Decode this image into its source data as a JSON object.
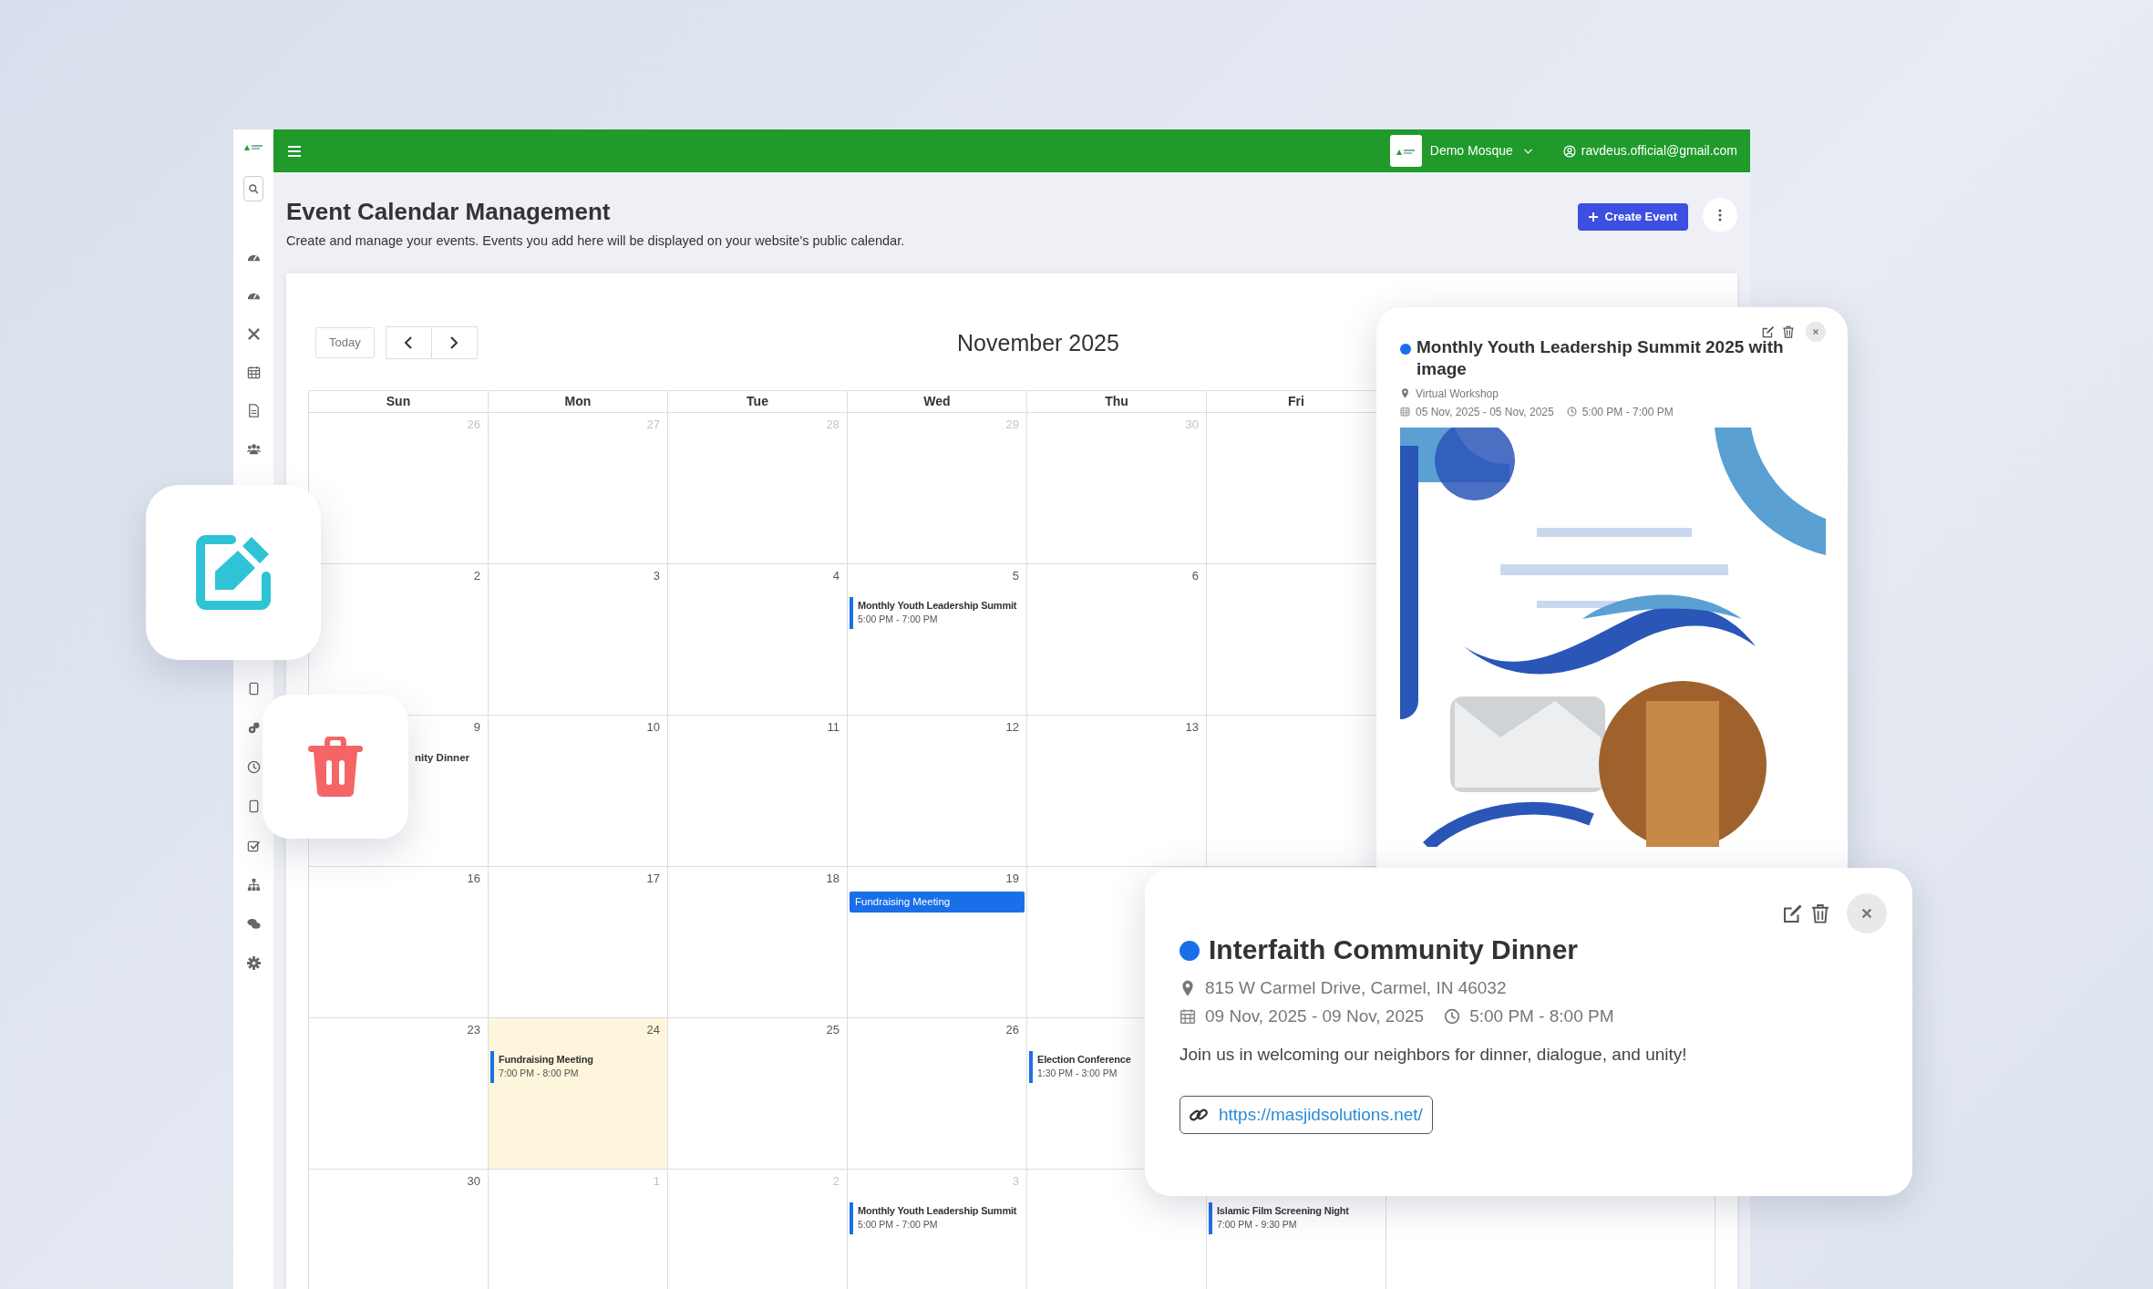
{
  "topbar": {
    "account": "Demo Mosque",
    "email": "ravdeus.official@gmail.com"
  },
  "header": {
    "title": "Event Calendar Management",
    "subtitle": "Create and manage your events. Events you add here will be displayed on your website's public calendar.",
    "create_button": "Create Event"
  },
  "calendar": {
    "today_button": "Today",
    "month_title": "November 2025",
    "weekdays": [
      "Sun",
      "Mon",
      "Tue",
      "Wed",
      "Thu",
      "Fri"
    ],
    "weeks": [
      [
        {
          "kind": "day",
          "day": "26",
          "outside": true,
          "today": false
        },
        {
          "kind": "day",
          "day": "27",
          "outside": true,
          "today": false
        },
        {
          "kind": "day",
          "day": "28",
          "outside": true,
          "today": false
        },
        {
          "kind": "day",
          "day": "29",
          "outside": true,
          "today": false
        },
        {
          "kind": "day",
          "day": "30",
          "outside": true,
          "today": false
        },
        {
          "kind": "blank"
        }
      ],
      [
        {
          "kind": "day",
          "day": "2",
          "outside": false,
          "today": false
        },
        {
          "kind": "day",
          "day": "3",
          "outside": false,
          "today": false
        },
        {
          "kind": "day",
          "day": "4",
          "outside": false,
          "today": false
        },
        {
          "kind": "day",
          "day": "5",
          "outside": false,
          "today": false,
          "events": [
            {
              "kind": "bar",
              "title": "Monthly Youth Leadership Summit",
              "time": "5:00 PM - 7:00 PM"
            }
          ]
        },
        {
          "kind": "day",
          "day": "6",
          "outside": false,
          "today": false
        },
        {
          "kind": "blank"
        }
      ],
      [
        {
          "kind": "day",
          "day": "9",
          "outside": false,
          "today": false,
          "events": [
            {
              "kind": "clipped",
              "title": "nity Dinner"
            }
          ]
        },
        {
          "kind": "day",
          "day": "10",
          "outside": false,
          "today": false
        },
        {
          "kind": "day",
          "day": "11",
          "outside": false,
          "today": false
        },
        {
          "kind": "day",
          "day": "12",
          "outside": false,
          "today": false
        },
        {
          "kind": "day",
          "day": "13",
          "outside": false,
          "today": false
        },
        {
          "kind": "blank"
        }
      ],
      [
        {
          "kind": "day",
          "day": "16",
          "outside": false,
          "today": false
        },
        {
          "kind": "day",
          "day": "17",
          "outside": false,
          "today": false
        },
        {
          "kind": "day",
          "day": "18",
          "outside": false,
          "today": false
        },
        {
          "kind": "day",
          "day": "19",
          "outside": false,
          "today": false,
          "events": [
            {
              "kind": "block",
              "title": "Fundraising Meeting"
            }
          ]
        },
        {
          "kind": "blank"
        },
        {
          "kind": "blank"
        }
      ],
      [
        {
          "kind": "day",
          "day": "23",
          "outside": false,
          "today": false
        },
        {
          "kind": "day",
          "day": "24",
          "outside": false,
          "today": true,
          "events": [
            {
              "kind": "bar",
              "title": "Fundraising Meeting",
              "time": "7:00 PM - 8:00 PM"
            }
          ]
        },
        {
          "kind": "day",
          "day": "25",
          "outside": false,
          "today": false
        },
        {
          "kind": "day",
          "day": "26",
          "outside": false,
          "today": false
        },
        {
          "kind": "blank",
          "events": [
            {
              "kind": "bar",
              "title": "Election Conference",
              "time": "1:30 PM - 3:00 PM"
            }
          ]
        },
        {
          "kind": "blank"
        }
      ],
      [
        {
          "kind": "day",
          "day": "30",
          "outside": false,
          "today": false
        },
        {
          "kind": "day",
          "day": "1",
          "outside": true,
          "today": false
        },
        {
          "kind": "day",
          "day": "2",
          "outside": true,
          "today": false
        },
        {
          "kind": "day",
          "day": "3",
          "outside": true,
          "today": false,
          "events": [
            {
              "kind": "bar",
              "title": "Monthly Youth Leadership Summit",
              "time": "5:00 PM - 7:00 PM"
            }
          ]
        },
        {
          "kind": "blank"
        },
        {
          "kind": "blank",
          "events": [
            {
              "kind": "bar",
              "title": "Islamic Film Screening Night",
              "time": "7:00 PM - 9:30 PM"
            }
          ]
        }
      ]
    ]
  },
  "event_popups": [
    {
      "title": "Monthly Youth Leadership Summit 2025 with image",
      "color": "#1a6fe8",
      "location": "Virtual Workshop",
      "dates": "05 Nov, 2025 - 05 Nov, 2025",
      "time": "5:00 PM - 7:00 PM"
    },
    {
      "title": "Interfaith Community Dinner",
      "color": "#1a6fe8",
      "location": "815 W Carmel Drive, Carmel, IN 46032",
      "dates": "09 Nov, 2025 - 09 Nov, 2025",
      "time": "5:00 PM - 8:00 PM",
      "description": "Join us in welcoming our neighbors for dinner, dialogue, and unity!",
      "link": "https://masjidsolutions.net/"
    }
  ]
}
